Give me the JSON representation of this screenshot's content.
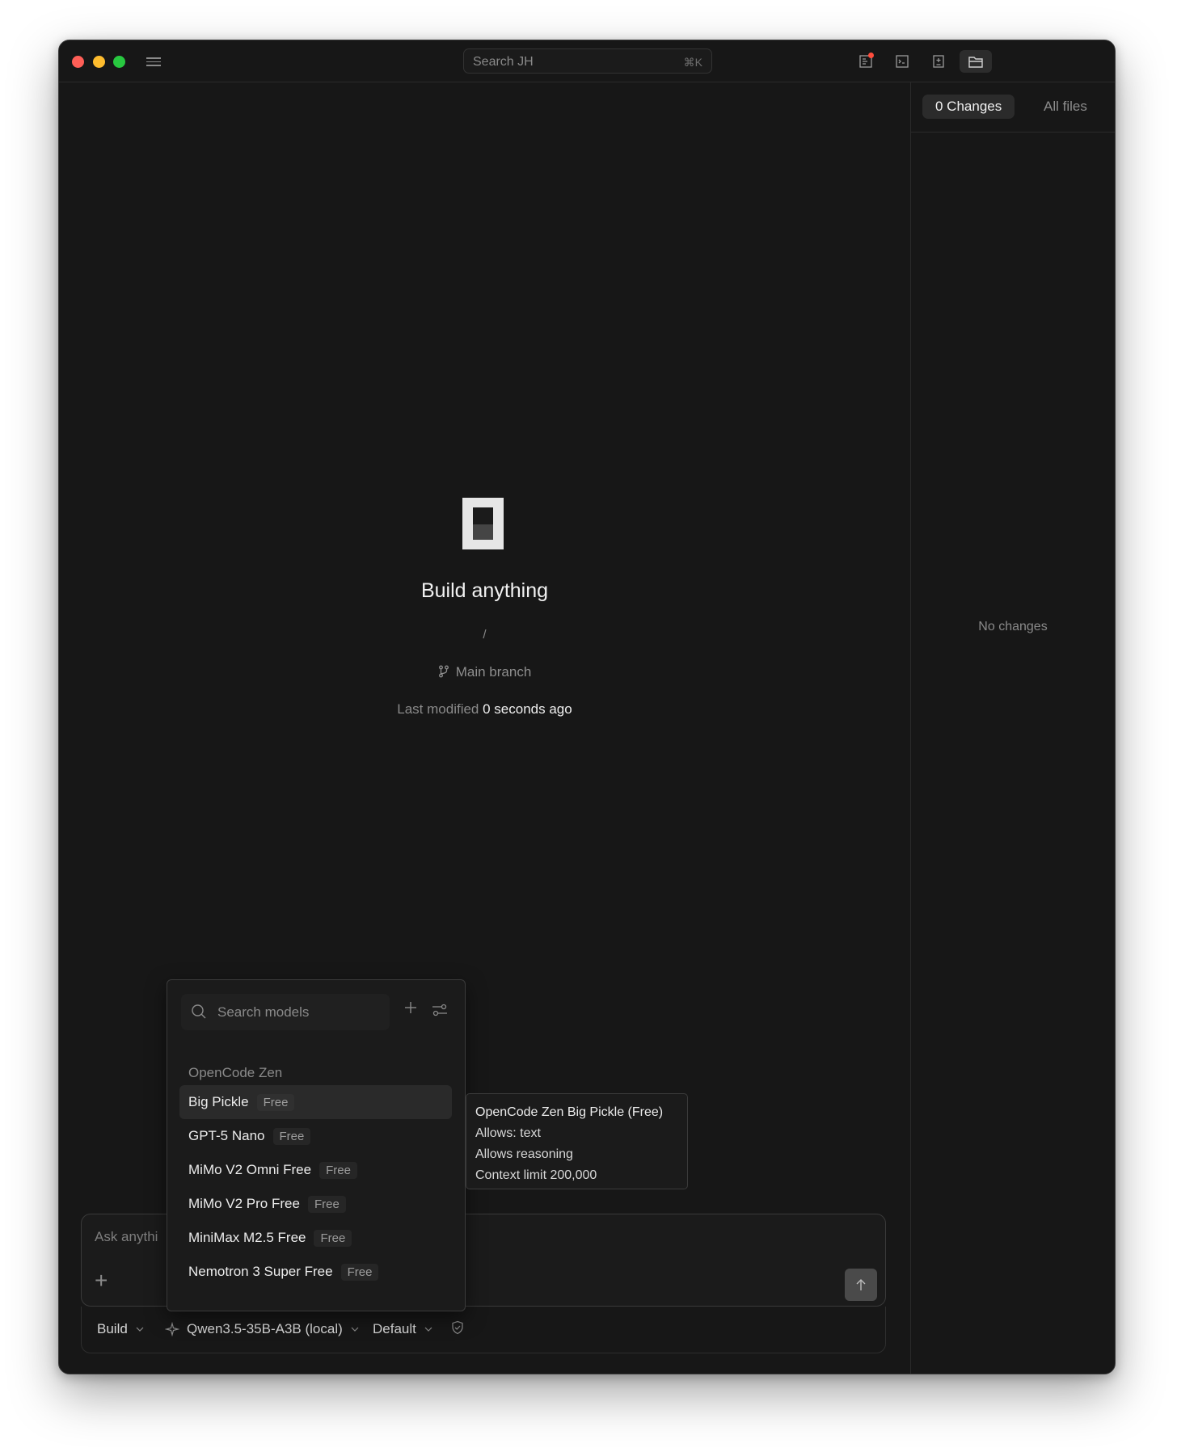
{
  "titlebar": {
    "search_placeholder": "Search JH",
    "search_shortcut": "⌘K",
    "icons": [
      "review-icon",
      "terminal-icon",
      "diff-icon",
      "files-icon"
    ]
  },
  "right_panel": {
    "tabs": [
      {
        "label": "0 Changes",
        "active": true
      },
      {
        "label": "All files",
        "active": false
      }
    ],
    "empty_text": "No changes"
  },
  "center": {
    "title": "Build anything",
    "path": "/",
    "branch": "Main branch",
    "modified_prefix": "Last modified",
    "modified_value": "0 seconds ago"
  },
  "composer": {
    "placeholder": "Ask anything...",
    "visible_placeholder": "Ask anythi"
  },
  "footer": {
    "agent": "Build",
    "model": "Qwen3.5-35B-A3B (local)",
    "variant": "Default"
  },
  "model_picker": {
    "search_placeholder": "Search models",
    "group": "OpenCode Zen",
    "items": [
      {
        "name": "Big Pickle",
        "badge": "Free",
        "active": true
      },
      {
        "name": "GPT-5 Nano",
        "badge": "Free",
        "active": false
      },
      {
        "name": "MiMo V2 Omni Free",
        "badge": "Free",
        "active": false
      },
      {
        "name": "MiMo V2 Pro Free",
        "badge": "Free",
        "active": false
      },
      {
        "name": "MiniMax M2.5 Free",
        "badge": "Free",
        "active": false
      },
      {
        "name": "Nemotron 3 Super Free",
        "badge": "Free",
        "active": false
      }
    ]
  },
  "tooltip": {
    "title": "OpenCode Zen Big Pickle (Free)",
    "line1": "Allows: text",
    "line2": "Allows reasoning",
    "line3": "Context limit 200,000"
  },
  "colors": {
    "background": "#171717",
    "accent_red": "#ff4d3d",
    "traffic_red": "#ff5f57",
    "traffic_yellow": "#febc2e",
    "traffic_green": "#28c840"
  }
}
